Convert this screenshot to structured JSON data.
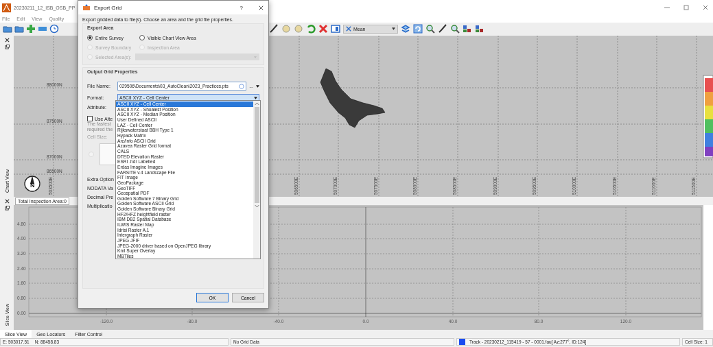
{
  "window": {
    "title": "20230211_12_ISB_OSB_PP"
  },
  "menu": [
    "File",
    "Edit",
    "View",
    "Quality"
  ],
  "toolbar": {
    "statistic": "Mean"
  },
  "chart_view": {
    "label": "Chart View",
    "north_label": "N",
    "northings": [
      "88000N",
      "87500N",
      "87000N",
      "86500N"
    ],
    "eastings": [
      "503500E",
      "506500E",
      "507000E",
      "507500E",
      "508000E",
      "508500E",
      "509000E",
      "509500E",
      "510000E",
      "510500E",
      "511000E",
      "511500E"
    ]
  },
  "slice_view": {
    "label": "Slice View",
    "total_area": "Total Inspection Area:0",
    "y_ticks": [
      "4.80",
      "4.00",
      "3.20",
      "2.40",
      "1.60",
      "0.80",
      "0.00"
    ],
    "x_ticks": [
      "-120.0",
      "-80.0",
      "-40.0",
      "0.0",
      "40.0",
      "80.0",
      "120.0"
    ]
  },
  "bottom_tabs": [
    {
      "label": "Slice View",
      "selected": true
    },
    {
      "label": "Geo Locators",
      "selected": false
    },
    {
      "label": "Filter Control",
      "selected": false
    }
  ],
  "status_bar": {
    "easting": "E: 503017.51",
    "northing": "N: 88458.83",
    "grid": "No Grid Data",
    "track": {
      "color": "#1a4cf0",
      "text": "Track - 20230212_115419 - 57 - 0001.fau[ Az:277°, ID:124]"
    },
    "cell_size": "Cell Size: 1"
  },
  "dialog": {
    "title": "Export Grid",
    "help": "?",
    "description": "Export gridded data to file(s). Choose an area and the grid file properties.",
    "export_area": {
      "title": "Export Area",
      "options": [
        {
          "label": "Entire Survey",
          "selected": true,
          "disabled": false
        },
        {
          "label": "Visible Chart View Area",
          "selected": false,
          "disabled": false
        },
        {
          "label": "Survey Boundary",
          "selected": false,
          "disabled": true
        },
        {
          "label": "Inspection Area",
          "selected": false,
          "disabled": true
        },
        {
          "label": "Selected Area(s):",
          "selected": false,
          "disabled": true
        }
      ]
    },
    "output": {
      "title": "Output Grid Properties",
      "file_name_label": "File Name:",
      "file_name": "029506\\Documents\\03_AutoClean\\2023_Practices.pts",
      "browse": "...",
      "format_label": "Format:",
      "format": "ASCII XYZ - Cell Center",
      "attribute_label": "Attribute:",
      "use_alt": {
        "label": "Use Alte",
        "checked": false
      },
      "hint_lines": [
        "The fastest",
        "required the"
      ],
      "cell_size_label": "Cell Size:",
      "lower_labels": [
        "Extra Option",
        "NODATA Va",
        "Decimal Pre",
        "Multiplicatio"
      ],
      "format_options": [
        {
          "label": "ASCII XYZ - Cell Center",
          "selected": true
        },
        {
          "label": "ASCII XYZ - Shoalest Position",
          "selected": false
        },
        {
          "label": "ASCII XYZ - Median Position",
          "selected": false
        },
        {
          "label": "User Defined ASCII",
          "selected": false
        },
        {
          "label": "LAZ - Cell Center",
          "selected": false
        },
        {
          "label": "Rijkswaterstaat BBH Type 1",
          "selected": false
        },
        {
          "label": "Hypack Matrix",
          "selected": false
        },
        {
          "label": "Arc/Info ASCII Grid",
          "selected": false
        },
        {
          "label": "Azavea Raster Grid format",
          "selected": false
        },
        {
          "label": "CALS",
          "selected": false
        },
        {
          "label": "DTED Elevation Raster",
          "selected": false
        },
        {
          "label": "ESRI .hdr Labelled",
          "selected": false
        },
        {
          "label": "Erdas Imagine Images",
          "selected": false
        },
        {
          "label": "FARSITE v.4 Landscape File",
          "selected": false
        },
        {
          "label": "FIT Image",
          "selected": false
        },
        {
          "label": "GeoPackage",
          "selected": false
        },
        {
          "label": "GeoTIFF",
          "selected": false
        },
        {
          "label": "Geospatial PDF",
          "selected": false
        },
        {
          "label": "Golden Software 7 Binary Grid",
          "selected": false
        },
        {
          "label": "Golden Software ASCII Grid",
          "selected": false
        },
        {
          "label": "Golden Software Binary Grid",
          "selected": false
        },
        {
          "label": "HF2/HFZ heightfield raster",
          "selected": false
        },
        {
          "label": "IBM DB2 Spatial Database",
          "selected": false
        },
        {
          "label": "ILWIS Raster Map",
          "selected": false
        },
        {
          "label": "Idrisi Raster A.1",
          "selected": false
        },
        {
          "label": "Intergraph Raster",
          "selected": false
        },
        {
          "label": "JPEG JFIF",
          "selected": false
        },
        {
          "label": "JPEG-2000 driver based on OpenJPEG library",
          "selected": false
        },
        {
          "label": "Kml Super Overlay",
          "selected": false
        },
        {
          "label": "MBTiles",
          "selected": false
        }
      ]
    },
    "buttons": [
      "OK",
      "Cancel"
    ]
  }
}
